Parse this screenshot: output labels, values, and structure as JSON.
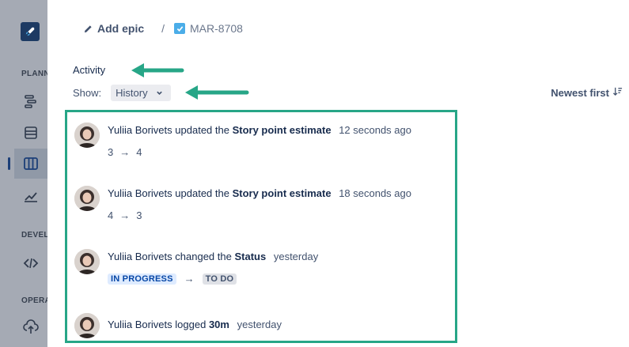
{
  "sidebar": {
    "sections": [
      {
        "label": "PLANNING"
      },
      {
        "label": "DEVELOPMENT"
      },
      {
        "label": "OPERATIONS"
      }
    ],
    "icons": [
      "rocket-icon",
      "timeline-icon",
      "backlog-icon",
      "board-icon",
      "reports-icon",
      "code-icon",
      "deployments-icon"
    ]
  },
  "breadcrumb": {
    "add_epic": "Add epic",
    "separator": "/",
    "issue_key": "MAR-8708"
  },
  "activity": {
    "title": "Activity",
    "show_label": "Show:",
    "show_value": "History",
    "sort_label": "Newest first"
  },
  "entries": [
    {
      "user": "Yuliia Borivets",
      "verb": "updated the",
      "field": "Story point estimate",
      "time": "12 seconds ago",
      "from": "3",
      "to": "4"
    },
    {
      "user": "Yuliia Borivets",
      "verb": "updated the",
      "field": "Story point estimate",
      "time": "18 seconds ago",
      "from": "4",
      "to": "3"
    },
    {
      "user": "Yuliia Borivets",
      "verb": "changed the",
      "field": "Status",
      "time": "yesterday",
      "from": "IN PROGRESS",
      "to": "TO DO"
    },
    {
      "user": "Yuliia Borivets",
      "verb": "logged",
      "field": "30m",
      "time": "yesterday"
    }
  ],
  "arrow_glyph": "→",
  "colors": {
    "annotation": "#27a687",
    "sidebar_bg": "#a5aab4",
    "lozenge_in_progress": "#deebff",
    "lozenge_todo": "#dfe1e6"
  }
}
